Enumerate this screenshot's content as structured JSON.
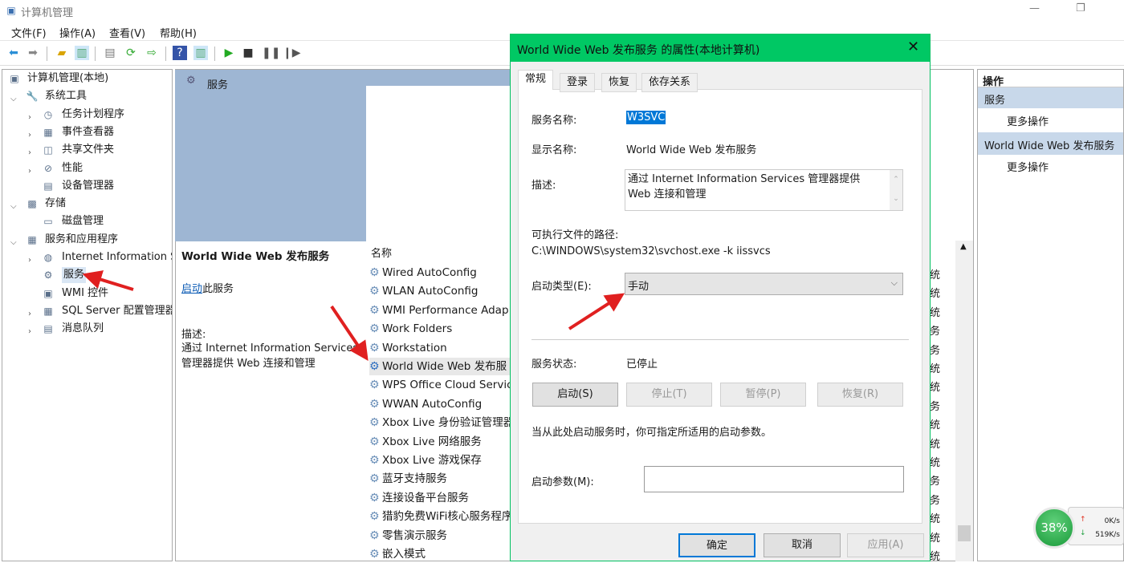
{
  "window": {
    "title": "计算机管理"
  },
  "menu": [
    "文件(F)",
    "操作(A)",
    "查看(V)",
    "帮助(H)"
  ],
  "toolbar_icons": [
    "back-icon",
    "forward-icon",
    "up-folder-icon",
    "show-hide-tree-icon",
    "properties-icon",
    "refresh-icon",
    "export-icon",
    "help-icon",
    "show-action-pane-icon",
    "start-icon",
    "stop-icon",
    "pause-icon",
    "resume-icon"
  ],
  "tree": [
    {
      "label": "计算机管理(本地)",
      "level": 0
    },
    {
      "label": "系统工具",
      "level": 1,
      "expanded": true
    },
    {
      "label": "任务计划程序",
      "level": 2,
      "expander": true
    },
    {
      "label": "事件查看器",
      "level": 2,
      "expander": true
    },
    {
      "label": "共享文件夹",
      "level": 2,
      "expander": true
    },
    {
      "label": "性能",
      "level": 2,
      "expander": true
    },
    {
      "label": "设备管理器",
      "level": 2
    },
    {
      "label": "存储",
      "level": 1,
      "expanded": true
    },
    {
      "label": "磁盘管理",
      "level": 2
    },
    {
      "label": "服务和应用程序",
      "level": 1,
      "expanded": true
    },
    {
      "label": "Internet Information S",
      "level": 2,
      "expander": true
    },
    {
      "label": "服务",
      "level": 2,
      "selected": true
    },
    {
      "label": "WMI 控件",
      "level": 2
    },
    {
      "label": "SQL Server 配置管理器",
      "level": 2,
      "expander": true
    },
    {
      "label": "消息队列",
      "level": 2,
      "expander": true
    }
  ],
  "middle": {
    "header": "服务",
    "detail_title": "World Wide Web 发布服务",
    "start_link": "启动",
    "start_suffix": "此服务",
    "desc_label": "描述:",
    "desc_text": "通过 Internet Information Services 管理器提供 Web 连接和管理",
    "column_name": "名称",
    "services": [
      "Wired AutoConfig",
      "WLAN AutoConfig",
      "WMI Performance Adap",
      "Work Folders",
      "Workstation",
      "World Wide Web 发布服",
      "WPS Office Cloud Servic",
      "WWAN AutoConfig",
      "Xbox Live 身份验证管理器",
      "Xbox Live 网络服务",
      "Xbox Live 游戏保存",
      "蓝牙支持服务",
      "连接设备平台服务",
      "猎豹免费WiFi核心服务程序",
      "零售演示服务",
      "嵌入模式"
    ],
    "selected_index": 5,
    "right_column": [
      "统",
      "统",
      "统",
      "务",
      "务",
      "统",
      "统",
      "务",
      "统",
      "统",
      "统",
      "务",
      "务",
      "统",
      "统",
      "统"
    ]
  },
  "actions": {
    "header": "操作",
    "sections": [
      {
        "title": "服务",
        "item": "更多操作"
      },
      {
        "title": "World Wide Web 发布服务",
        "item": "更多操作"
      }
    ]
  },
  "dialog": {
    "title": "World Wide Web 发布服务 的属性(本地计算机)",
    "tabs": [
      "常规",
      "登录",
      "恢复",
      "依存关系"
    ],
    "active_tab": 0,
    "service_name_label": "服务名称:",
    "service_name": "W3SVC",
    "display_name_label": "显示名称:",
    "display_name": "World Wide Web 发布服务",
    "description_label": "描述:",
    "description": "通过 Internet Information Services 管理器提供 Web 连接和管理",
    "path_label": "可执行文件的路径:",
    "path": "C:\\WINDOWS\\system32\\svchost.exe -k iissvcs",
    "startup_type_label": "启动类型(E):",
    "startup_type": "手动",
    "status_label": "服务状态:",
    "status": "已停止",
    "buttons": {
      "start": "启动(S)",
      "stop": "停止(T)",
      "pause": "暂停(P)",
      "resume": "恢复(R)"
    },
    "hint": "当从此处启动服务时，你可指定所适用的启动参数。",
    "params_label": "启动参数(M):",
    "params_value": "",
    "ok": "确定",
    "cancel": "取消",
    "apply": "应用(A)"
  },
  "net_widget": {
    "percent": "38%",
    "up": "0K/s",
    "down": "519K/s"
  },
  "colors": {
    "accent": "#00c864",
    "selection": "#0078d7",
    "header_blue": "#9eb6d3",
    "arrow": "#e02020"
  }
}
